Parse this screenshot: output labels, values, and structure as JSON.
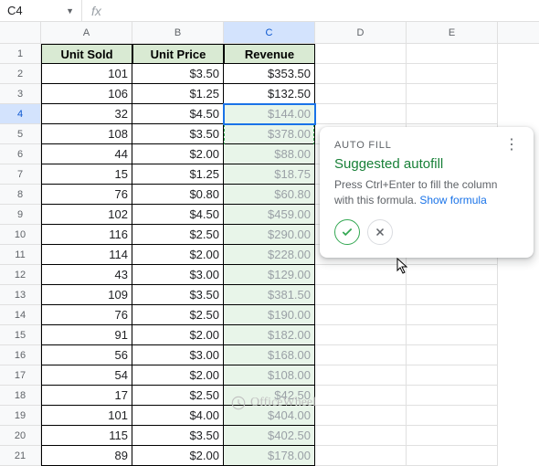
{
  "nameBox": "C4",
  "fxLabel": "fx",
  "columns": [
    "A",
    "B",
    "C",
    "D",
    "E"
  ],
  "tableHeaders": [
    "Unit Sold",
    "Unit Price",
    "Revenue"
  ],
  "rows": [
    {
      "n": 1,
      "sold": "",
      "price": "",
      "rev": ""
    },
    {
      "n": 2,
      "sold": "101",
      "price": "$3.50",
      "rev": "$353.50"
    },
    {
      "n": 3,
      "sold": "106",
      "price": "$1.25",
      "rev": "$132.50"
    },
    {
      "n": 4,
      "sold": "32",
      "price": "$4.50",
      "rev": "$144.00"
    },
    {
      "n": 5,
      "sold": "108",
      "price": "$3.50",
      "rev": "$378.00"
    },
    {
      "n": 6,
      "sold": "44",
      "price": "$2.00",
      "rev": "$88.00"
    },
    {
      "n": 7,
      "sold": "15",
      "price": "$1.25",
      "rev": "$18.75"
    },
    {
      "n": 8,
      "sold": "76",
      "price": "$0.80",
      "rev": "$60.80"
    },
    {
      "n": 9,
      "sold": "102",
      "price": "$4.50",
      "rev": "$459.00"
    },
    {
      "n": 10,
      "sold": "116",
      "price": "$2.50",
      "rev": "$290.00"
    },
    {
      "n": 11,
      "sold": "114",
      "price": "$2.00",
      "rev": "$228.00"
    },
    {
      "n": 12,
      "sold": "43",
      "price": "$3.00",
      "rev": "$129.00"
    },
    {
      "n": 13,
      "sold": "109",
      "price": "$3.50",
      "rev": "$381.50"
    },
    {
      "n": 14,
      "sold": "76",
      "price": "$2.50",
      "rev": "$190.00"
    },
    {
      "n": 15,
      "sold": "91",
      "price": "$2.00",
      "rev": "$182.00"
    },
    {
      "n": 16,
      "sold": "56",
      "price": "$3.00",
      "rev": "$168.00"
    },
    {
      "n": 17,
      "sold": "54",
      "price": "$2.00",
      "rev": "$108.00"
    },
    {
      "n": 18,
      "sold": "17",
      "price": "$2.50",
      "rev": "$42.50"
    },
    {
      "n": 19,
      "sold": "101",
      "price": "$4.00",
      "rev": "$404.00"
    },
    {
      "n": 20,
      "sold": "115",
      "price": "$3.50",
      "rev": "$402.50"
    },
    {
      "n": 21,
      "sold": "89",
      "price": "$2.00",
      "rev": "$178.00"
    }
  ],
  "popup": {
    "label": "AUTO FILL",
    "title": "Suggested autofill",
    "desc": "Press Ctrl+Enter to fill the column with this formula. ",
    "link": "Show formula"
  },
  "watermark": "OfficeWheel"
}
